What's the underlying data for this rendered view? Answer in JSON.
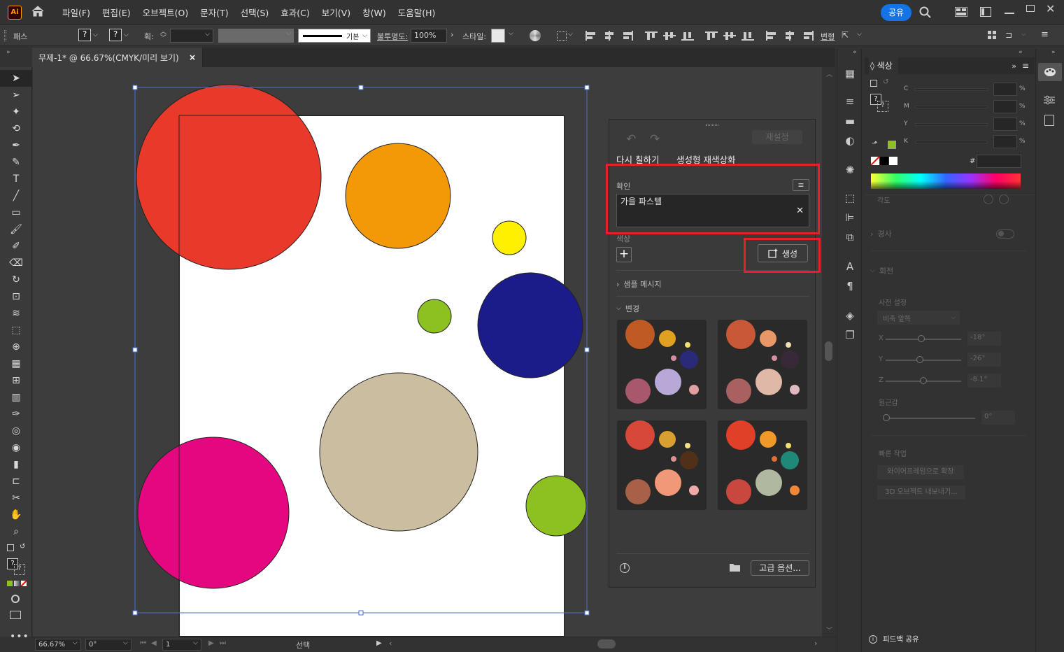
{
  "app": {
    "logo": "Ai"
  },
  "menu": [
    "파일(F)",
    "편집(E)",
    "오브젝트(O)",
    "문자(T)",
    "선택(S)",
    "효과(C)",
    "보기(V)",
    "창(W)",
    "도움말(H)"
  ],
  "header": {
    "share_label": "공유"
  },
  "control": {
    "selection_type": "패스",
    "stroke_label": "획:",
    "stroke_style": "기본",
    "opacity_label": "불투명도:",
    "opacity_value": "100%",
    "style_label": "스타일:",
    "transform_label": "변형"
  },
  "document": {
    "tab_title": "무제-1* @ 66.67%(CMYK/미리 보기)"
  },
  "status": {
    "zoom": "66.67%",
    "rotation": "0°",
    "artboard": "1",
    "tool": "선택"
  },
  "recolor": {
    "reset_label": "재설정",
    "tab_recolor": "다시 칠하기",
    "tab_generative": "생성형 재색상화",
    "prompt_label": "확인",
    "prompt_value": "가을 파스텔",
    "colors_label": "색상",
    "generate_label": "생성",
    "samples_label": "샘플 메시지",
    "variations_label": "변경",
    "advanced_label": "고급 옵션..."
  },
  "color_panel": {
    "title": "색상",
    "channels": [
      "C",
      "M",
      "Y",
      "K"
    ],
    "pct": "%",
    "hex_label": "#"
  },
  "props": {
    "taper": "경사",
    "rotation": "회전",
    "preset_label": "사전 설정",
    "preset_value": "비축 앞쪽",
    "x_label": "X",
    "x_value": "-18°",
    "y_label": "Y",
    "y_value": "-26°",
    "z_label": "Z",
    "z_value": "-8.1°",
    "perspective": "원근감",
    "persp_value": "0°",
    "quick_actions": "빠른 작업",
    "qa1": "와이어프레임으로 확장",
    "qa2": "3D 오브젝트 내보내기...",
    "feedback": "피드백 공유"
  },
  "colors": {
    "accent_blue": "#1473e6",
    "highlight_red": "#e5202a",
    "circle_red": "#e8392b",
    "circle_orange": "#f39806",
    "circle_yellow": "#fff000",
    "circle_green": "#8cc121",
    "circle_navy": "#1b1c8a",
    "circle_tan": "#cbbea0",
    "circle_magenta": "#e5077f"
  },
  "variations": [
    {
      "colors": [
        "#c05a24",
        "#e0a020",
        "#f0e070",
        "#d88aa0",
        "#2a2a78",
        "#b8a8d8",
        "#a85868",
        "#e0a0a0"
      ]
    },
    {
      "colors": [
        "#c85838",
        "#e89868",
        "#f0e0b0",
        "#d890a0",
        "#382838",
        "#e0b8a8",
        "#a86060",
        "#e0b8c0"
      ]
    },
    {
      "colors": [
        "#d84838",
        "#d8a030",
        "#f0e080",
        "#d89090",
        "#503018",
        "#f09878",
        "#a86048",
        "#f0a8a8"
      ]
    },
    {
      "colors": [
        "#e04028",
        "#f09828",
        "#f0e070",
        "#e07030",
        "#208878",
        "#b0b8a0",
        "#c84840",
        "#f08838"
      ]
    }
  ]
}
